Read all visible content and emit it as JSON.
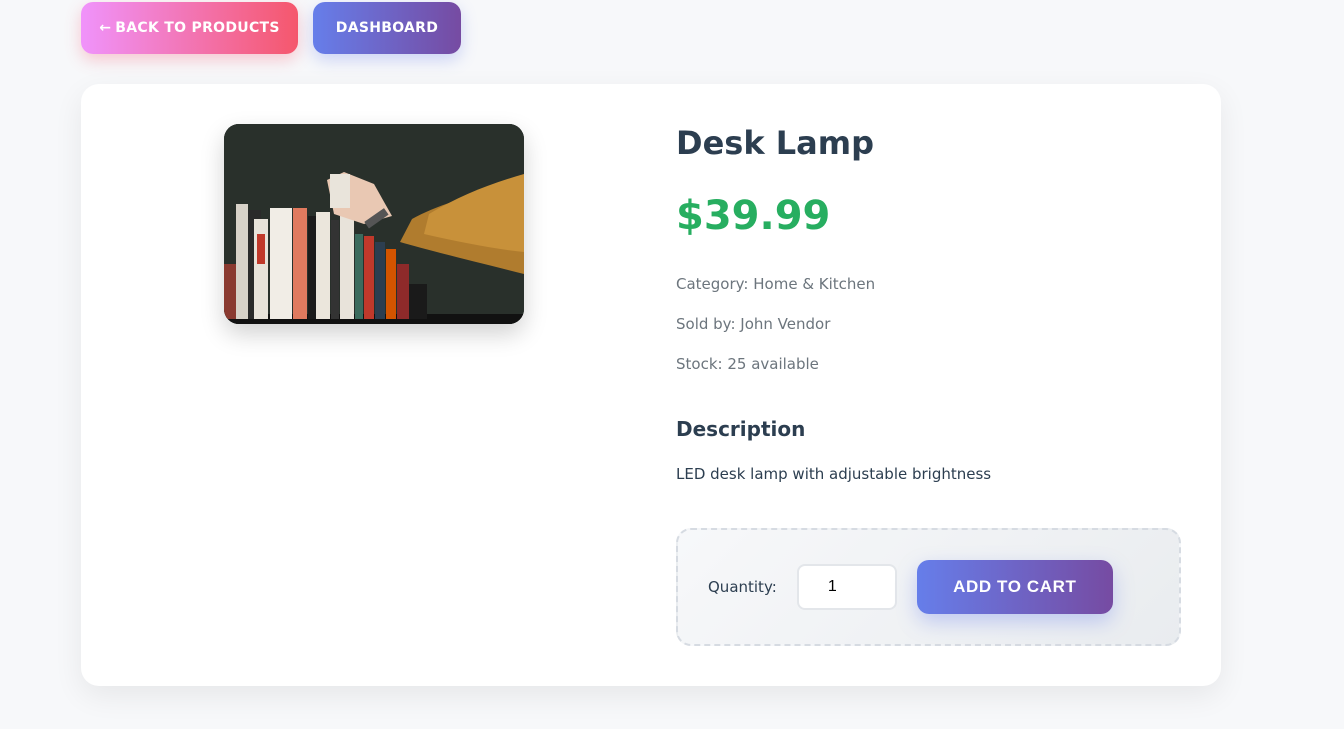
{
  "nav": {
    "back_arrow": "←",
    "back_label": "BACK TO PRODUCTS",
    "dashboard_label": "DASHBOARD"
  },
  "product": {
    "name": "Desk Lamp",
    "price": "$39.99",
    "category": "Category: Home & Kitchen",
    "seller": "Sold by: John Vendor",
    "stock": "Stock: 25 available",
    "description_heading": "Description",
    "description": "LED desk lamp with adjustable brightness"
  },
  "cart": {
    "quantity_label": "Quantity:",
    "quantity_value": "1",
    "add_label": "ADD TO CART"
  },
  "colors": {
    "price_green": "#27ae60",
    "accent_blue": "#667eea",
    "accent_purple": "#764ba2",
    "accent_pink": "#f5576c"
  }
}
